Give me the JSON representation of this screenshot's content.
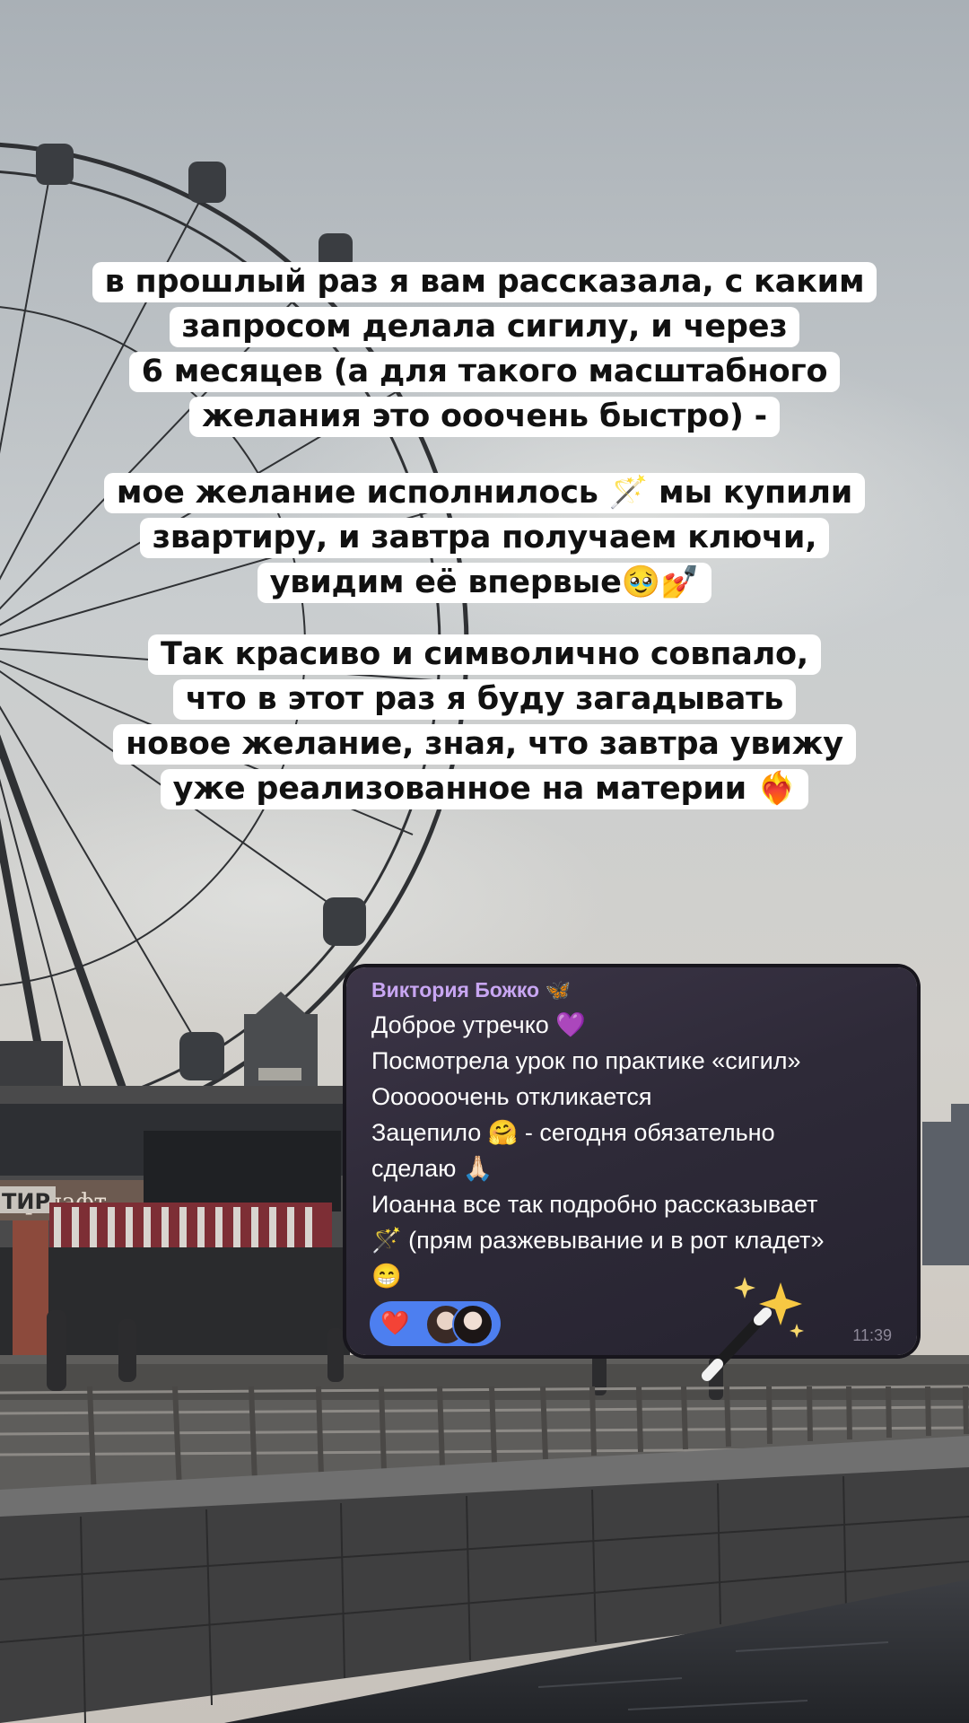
{
  "caption": {
    "paragraph1": [
      "в прошлый раз я вам рассказала, с каким",
      "запросом делала сигилу, и через",
      "6 месяцев (а для такого масштабного",
      "желания это ооочень быстро) -"
    ],
    "paragraph2": [
      "мое желание исполнилось 🪄 мы купили",
      "звартиру, и завтра получаем ключи,",
      "увидим её впервые🥹💅"
    ],
    "paragraph3": [
      "Так красиво и символично совпало,",
      "что в этот раз я буду загадывать",
      "новое желание, зная, что завтра увижу",
      "уже реализованное на материи ❤️‍🔥"
    ]
  },
  "chat_message": {
    "author": "Виктория Божко 🦋",
    "lines": [
      "Доброе утречко 💜",
      "Посмотрела урок по практике «сигил»",
      "Оооооочень откликается",
      "Зацепило 🤗 - сегодня обязательно",
      "сделаю 🙏🏻",
      "Иоанна все так подробно рассказывает",
      "🪄 (прям разжевывание и в рот кладет»",
      "😁"
    ],
    "reaction": "❤️",
    "time": "11:39",
    "colors": {
      "bubble": "#2e2a38",
      "author": "#c8a6f2",
      "reaction_pill": "#4d7ff0"
    }
  },
  "sticker": {
    "icon": "magic-wand-sparkles-icon"
  },
  "background": {
    "icon": "ferris-wheel-embankment-photo"
  },
  "sign": {
    "text": "ршафт",
    "text2": "ТИР"
  }
}
